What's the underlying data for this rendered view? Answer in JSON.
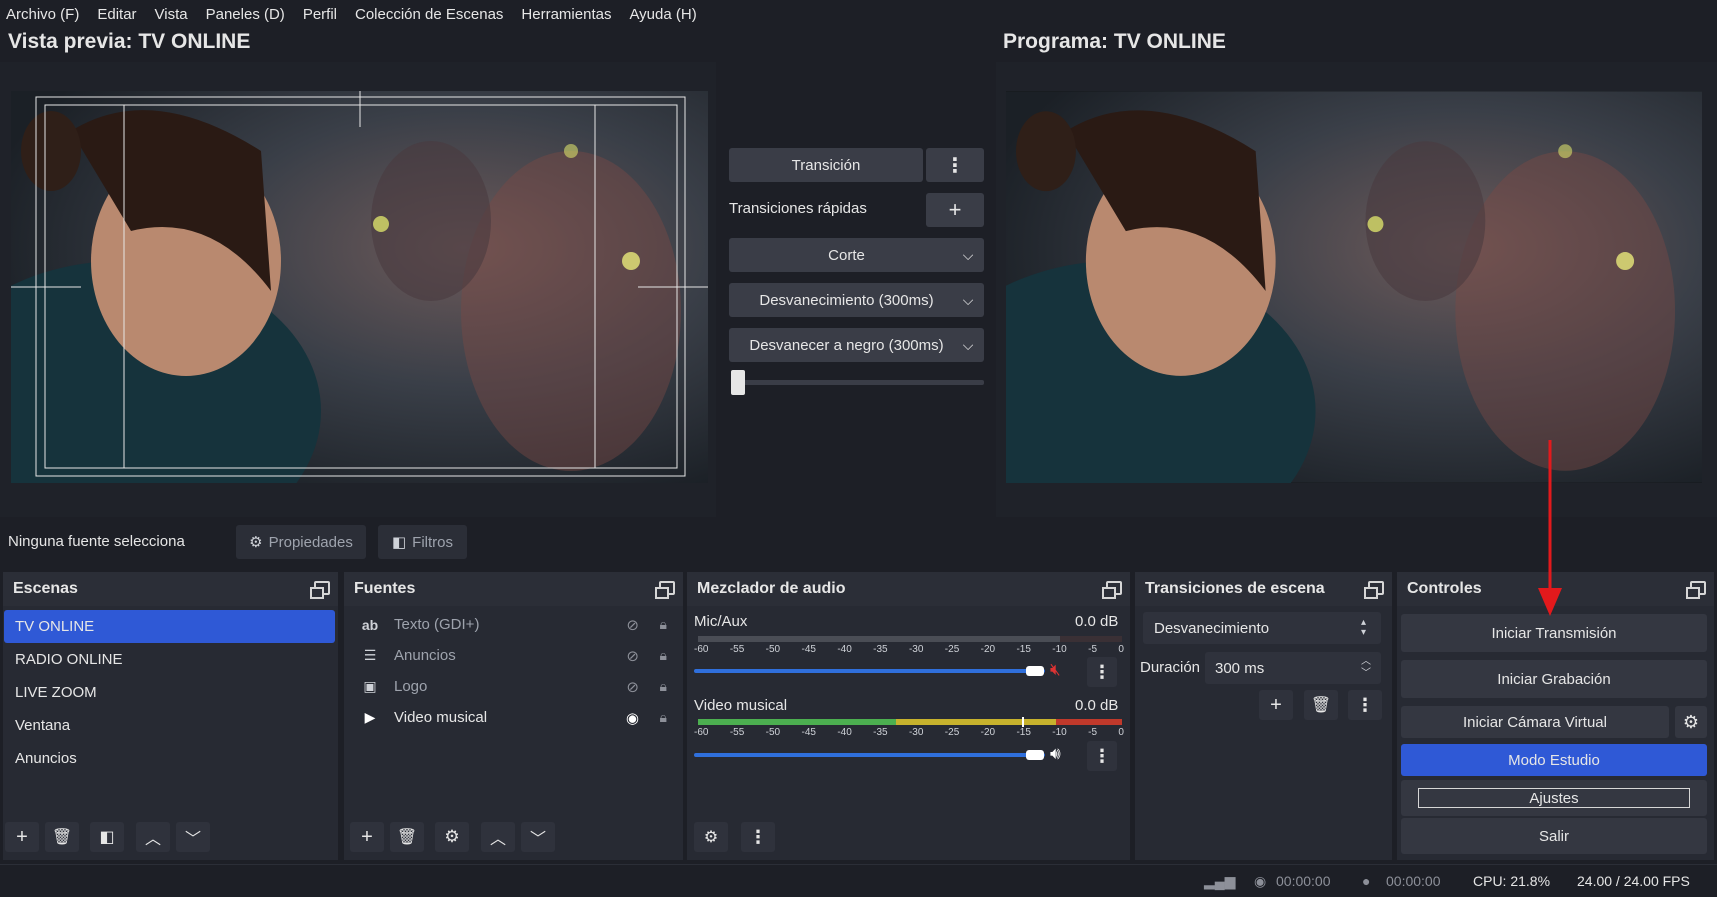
{
  "menu": [
    "Archivo (F)",
    "Editar",
    "Vista",
    "Paneles (D)",
    "Perfil",
    "Colección de Escenas",
    "Herramientas",
    "Ayuda (H)"
  ],
  "preview": {
    "title": "Vista previa: TV ONLINE"
  },
  "program": {
    "title": "Programa: TV ONLINE"
  },
  "transition_panel": {
    "transition_button": "Transición",
    "quick_label": "Transiciones rápidas",
    "items": [
      "Corte",
      "Desvanecimiento (300ms)",
      "Desvanecer a negro (300ms)"
    ],
    "tbar_level": 0.0
  },
  "context_bar": {
    "no_source": "Ninguna fuente selecciona",
    "properties": "Propiedades",
    "filters": "Filtros"
  },
  "scenes": {
    "title": "Escenas",
    "items": [
      "TV ONLINE",
      "RADIO ONLINE",
      "LIVE ZOOM",
      "Ventana",
      "Anuncios"
    ],
    "selected": "TV ONLINE"
  },
  "sources": {
    "title": "Fuentes",
    "items": [
      {
        "icon": "ab",
        "name": "Texto (GDI+)",
        "visible": false
      },
      {
        "icon": "☰",
        "name": "Anuncios",
        "visible": false
      },
      {
        "icon": "▣",
        "name": "Logo",
        "visible": false
      },
      {
        "icon": "▶",
        "name": "Video musical",
        "visible": true
      }
    ]
  },
  "mixer": {
    "title": "Mezclador de audio",
    "channels": [
      {
        "name": "Mic/Aux",
        "db": "0.0 dB",
        "muted": true,
        "volume": 1.0
      },
      {
        "name": "Video musical",
        "db": "0.0 dB",
        "muted": false,
        "volume": 1.0
      }
    ],
    "scale": [
      "-60",
      "-55",
      "-50",
      "-45",
      "-40",
      "-35",
      "-30",
      "-25",
      "-20",
      "-15",
      "-10",
      "-5",
      "0"
    ]
  },
  "scene_transitions": {
    "title": "Transiciones de escena",
    "selected": "Desvanecimiento",
    "duration_label": "Duración",
    "duration_value": "300 ms"
  },
  "controls": {
    "title": "Controles",
    "start_stream": "Iniciar Transmisión",
    "start_record": "Iniciar Grabación",
    "start_vcam": "Iniciar Cámara Virtual",
    "studio_mode": "Modo Estudio",
    "settings": "Ajustes",
    "exit": "Salir"
  },
  "status": {
    "rec_time": "00:00:00",
    "stream_time": "00:00:00",
    "cpu": "CPU: 21.8%",
    "fps": "24.00 / 24.00 FPS"
  },
  "colors": {
    "accent": "#2f59d6",
    "arrow": "#e3191c",
    "meter_green": "#4caf50",
    "meter_yellow": "#c7b22d",
    "meter_red": "#c0392b"
  }
}
